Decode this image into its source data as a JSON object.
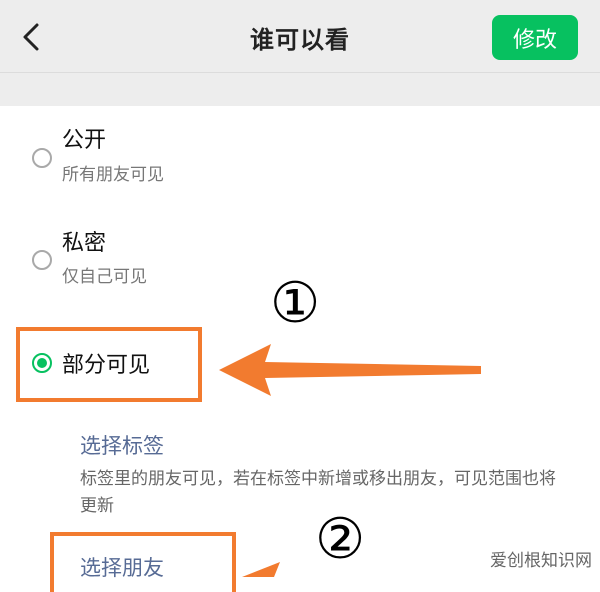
{
  "header": {
    "title": "谁可以看",
    "edit_label": "修改"
  },
  "options": [
    {
      "title": "公开",
      "desc": "所有朋友可见",
      "selected": false
    },
    {
      "title": "私密",
      "desc": "仅自己可见",
      "selected": false
    },
    {
      "title": "部分可见",
      "desc": "",
      "selected": true
    }
  ],
  "partial": {
    "select_tags_label": "选择标签",
    "select_tags_desc": "标签里的朋友可见，若在标签中新增或移出朋友，可见范围也将更新",
    "select_friends_label": "选择朋友"
  },
  "annotations": {
    "step1": "①",
    "step2": "②",
    "highlight_color": "#f27b2f"
  },
  "colors": {
    "accent": "#07c160",
    "link": "#576b95"
  },
  "watermark": "爱创根知识网"
}
